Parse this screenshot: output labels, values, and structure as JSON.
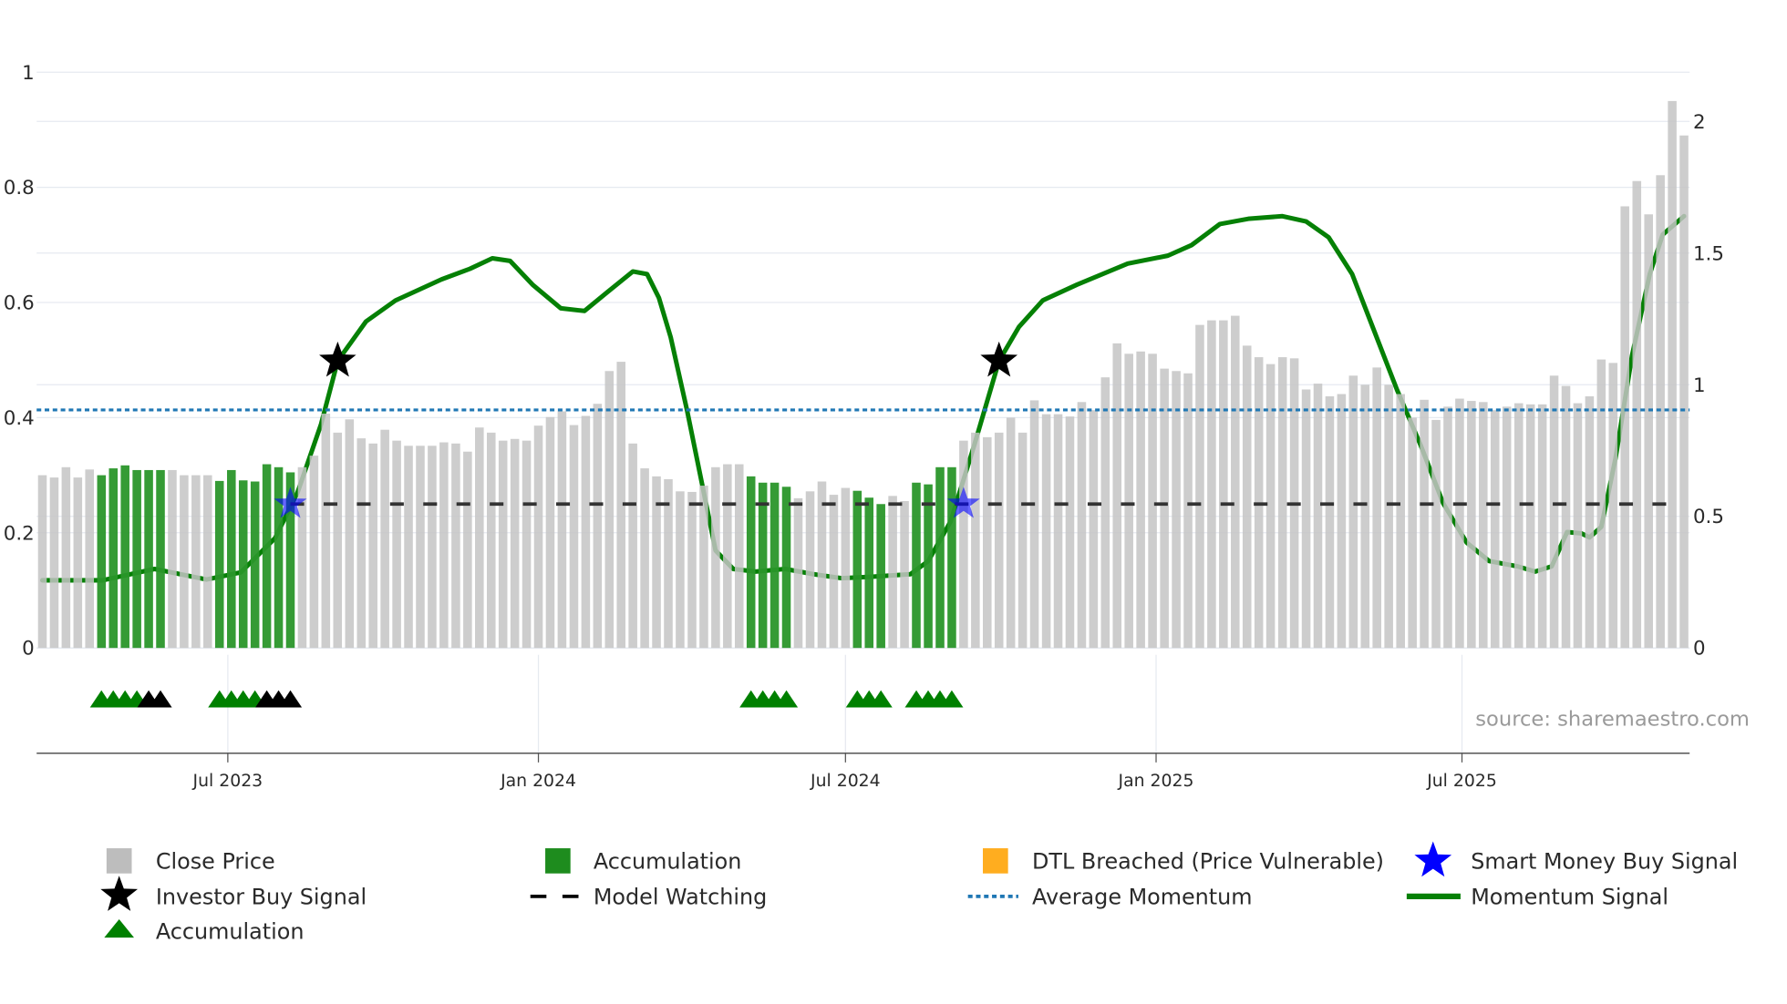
{
  "chart_data": {
    "type": "bar",
    "source": "source: sharemaestro.com",
    "x_ticks": [
      {
        "label": "Jul 2023",
        "week": 15.7
      },
      {
        "label": "Jan 2024",
        "week": 42.0
      },
      {
        "label": "Jul 2024",
        "week": 68.0
      },
      {
        "label": "Jan 2025",
        "week": 94.3
      },
      {
        "label": "Jul 2025",
        "week": 120.2
      }
    ],
    "left_axis": {
      "ylim": [
        0,
        1
      ],
      "ticks": [
        "0",
        "0.2",
        "0.4",
        "0.6",
        "0.8",
        "1"
      ],
      "tick_values": [
        0,
        0.2,
        0.4,
        0.6,
        0.8,
        1
      ]
    },
    "right_axis": {
      "ylim": [
        0,
        2
      ],
      "ticks": [
        "0",
        "0.5",
        "1",
        "1.5",
        "2"
      ],
      "tick_values": [
        0,
        0.5,
        1,
        1.5,
        2
      ]
    },
    "close_price": [
      0.3,
      0.296,
      0.314,
      0.296,
      0.31,
      0.3,
      0.312,
      0.317,
      0.309,
      0.309,
      0.309,
      0.309,
      0.3,
      0.3,
      0.3,
      0.29,
      0.309,
      0.291,
      0.289,
      0.319,
      0.314,
      0.305,
      0.314,
      0.334,
      0.407,
      0.374,
      0.397,
      0.364,
      0.355,
      0.379,
      0.36,
      0.351,
      0.351,
      0.351,
      0.357,
      0.355,
      0.341,
      0.383,
      0.374,
      0.36,
      0.363,
      0.36,
      0.386,
      0.401,
      0.411,
      0.387,
      0.403,
      0.424,
      0.481,
      0.497,
      0.355,
      0.312,
      0.298,
      0.293,
      0.272,
      0.271,
      0.282,
      0.314,
      0.319,
      0.319,
      0.298,
      0.287,
      0.287,
      0.28,
      0.26,
      0.272,
      0.289,
      0.266,
      0.278,
      0.273,
      0.261,
      0.25,
      0.264,
      0.255,
      0.287,
      0.284,
      0.314,
      0.314,
      0.36,
      0.374,
      0.366,
      0.374,
      0.4,
      0.374,
      0.43,
      0.406,
      0.406,
      0.402,
      0.427,
      0.413,
      0.47,
      0.529,
      0.511,
      0.515,
      0.511,
      0.485,
      0.481,
      0.477,
      0.561,
      0.569,
      0.569,
      0.577,
      0.525,
      0.505,
      0.493,
      0.505,
      0.503,
      0.449,
      0.459,
      0.437,
      0.441,
      0.473,
      0.457,
      0.487,
      0.457,
      0.441,
      0.4,
      0.431,
      0.396,
      0.419,
      0.433,
      0.429,
      0.427,
      0.413,
      0.419,
      0.425,
      0.423,
      0.423,
      0.473,
      0.455,
      0.425,
      0.437,
      0.501,
      0.495,
      0.767,
      0.811,
      0.753,
      0.821,
      0.95,
      0.89
    ],
    "accumulation_weeks": [
      5,
      6,
      7,
      8,
      9,
      10,
      15,
      16,
      17,
      18,
      19,
      20,
      21,
      60,
      61,
      62,
      63,
      69,
      70,
      71,
      74,
      75,
      76,
      77
    ],
    "momentum_signal": [
      [
        0,
        0.257
      ],
      [
        5.1,
        0.257
      ],
      [
        9.5,
        0.3
      ],
      [
        13.9,
        0.26
      ],
      [
        16.8,
        0.287
      ],
      [
        19.7,
        0.417
      ],
      [
        21.6,
        0.59
      ],
      [
        23.6,
        0.85
      ],
      [
        25,
        1.09
      ],
      [
        27.4,
        1.24
      ],
      [
        29.9,
        1.32
      ],
      [
        33.8,
        1.4
      ],
      [
        36.2,
        1.44
      ],
      [
        38.1,
        1.48
      ],
      [
        39.6,
        1.47
      ],
      [
        41.5,
        1.38
      ],
      [
        43.9,
        1.29
      ],
      [
        45.9,
        1.28
      ],
      [
        47.8,
        1.35
      ],
      [
        50,
        1.43
      ],
      [
        51.2,
        1.42
      ],
      [
        52.2,
        1.33
      ],
      [
        53.2,
        1.18
      ],
      [
        54.6,
        0.9
      ],
      [
        55.6,
        0.68
      ],
      [
        57,
        0.37
      ],
      [
        58.5,
        0.3
      ],
      [
        60.4,
        0.29
      ],
      [
        62.9,
        0.3
      ],
      [
        65.3,
        0.28
      ],
      [
        67.7,
        0.265
      ],
      [
        70.1,
        0.27
      ],
      [
        73.5,
        0.28
      ],
      [
        75,
        0.33
      ],
      [
        76.9,
        0.48
      ],
      [
        78.9,
        0.77
      ],
      [
        81,
        1.09
      ],
      [
        82.7,
        1.22
      ],
      [
        84.7,
        1.32
      ],
      [
        87.6,
        1.38
      ],
      [
        91.9,
        1.46
      ],
      [
        95.3,
        1.49
      ],
      [
        97.3,
        1.53
      ],
      [
        99.7,
        1.61
      ],
      [
        102.1,
        1.63
      ],
      [
        105,
        1.64
      ],
      [
        107,
        1.62
      ],
      [
        108.9,
        1.56
      ],
      [
        110.9,
        1.42
      ],
      [
        112.8,
        1.2
      ],
      [
        114.7,
        0.98
      ],
      [
        116.7,
        0.77
      ],
      [
        118.6,
        0.55
      ],
      [
        120.6,
        0.4
      ],
      [
        122.5,
        0.33
      ],
      [
        124.9,
        0.31
      ],
      [
        126.4,
        0.29
      ],
      [
        127.8,
        0.31
      ],
      [
        129.1,
        0.44
      ],
      [
        130.3,
        0.435
      ],
      [
        131,
        0.42
      ],
      [
        132,
        0.46
      ],
      [
        133.2,
        0.72
      ],
      [
        134.6,
        1.11
      ],
      [
        136.1,
        1.42
      ],
      [
        137.2,
        1.57
      ],
      [
        139,
        1.64
      ]
    ],
    "average_momentum": 0.904,
    "model_watching": {
      "value": 0.25,
      "from_week": 21,
      "to_week": 139
    },
    "investor_buy_signals": [
      {
        "week": 25,
        "value": 1.09
      },
      {
        "week": 81,
        "value": 1.09
      }
    ],
    "smart_money_buy_signals": [
      {
        "week": 21,
        "value": 0.25
      },
      {
        "week": 78,
        "value": 0.25
      }
    ],
    "markers": [
      {
        "week": 5,
        "color": "green"
      },
      {
        "week": 6,
        "color": "green"
      },
      {
        "week": 7,
        "color": "green"
      },
      {
        "week": 8,
        "color": "green"
      },
      {
        "week": 9,
        "color": "black"
      },
      {
        "week": 10,
        "color": "black"
      },
      {
        "week": 15,
        "color": "green"
      },
      {
        "week": 16,
        "color": "green"
      },
      {
        "week": 17,
        "color": "green"
      },
      {
        "week": 18,
        "color": "green"
      },
      {
        "week": 19,
        "color": "black"
      },
      {
        "week": 20,
        "color": "black"
      },
      {
        "week": 21,
        "color": "black"
      },
      {
        "week": 60,
        "color": "green"
      },
      {
        "week": 61,
        "color": "green"
      },
      {
        "week": 62,
        "color": "green"
      },
      {
        "week": 63,
        "color": "green"
      },
      {
        "week": 69,
        "color": "green"
      },
      {
        "week": 70,
        "color": "green"
      },
      {
        "week": 71,
        "color": "green"
      },
      {
        "week": 74,
        "color": "green"
      },
      {
        "week": 75,
        "color": "green"
      },
      {
        "week": 76,
        "color": "green"
      },
      {
        "week": 77,
        "color": "green"
      }
    ],
    "legend": {
      "close_price": "Close Price",
      "accumulation_bar": "Accumulation",
      "dtl_breached": "DTL Breached (Price Vulnerable)",
      "smart_money": "Smart Money Buy Signal",
      "investor_buy": "Investor Buy Signal",
      "model_watching": "Model Watching",
      "average_momentum": "Average Momentum",
      "momentum_signal": "Momentum Signal",
      "accumulation_marker": "Accumulation"
    },
    "colors": {
      "close": "#c4c4c4",
      "accumulation": "#2a962a",
      "dtl": "#ffad1f",
      "smart_money": "#0000ff",
      "momentum": "#058005",
      "average": "#1f77b4",
      "marker_green": "#008000",
      "marker_black": "#000000"
    }
  }
}
